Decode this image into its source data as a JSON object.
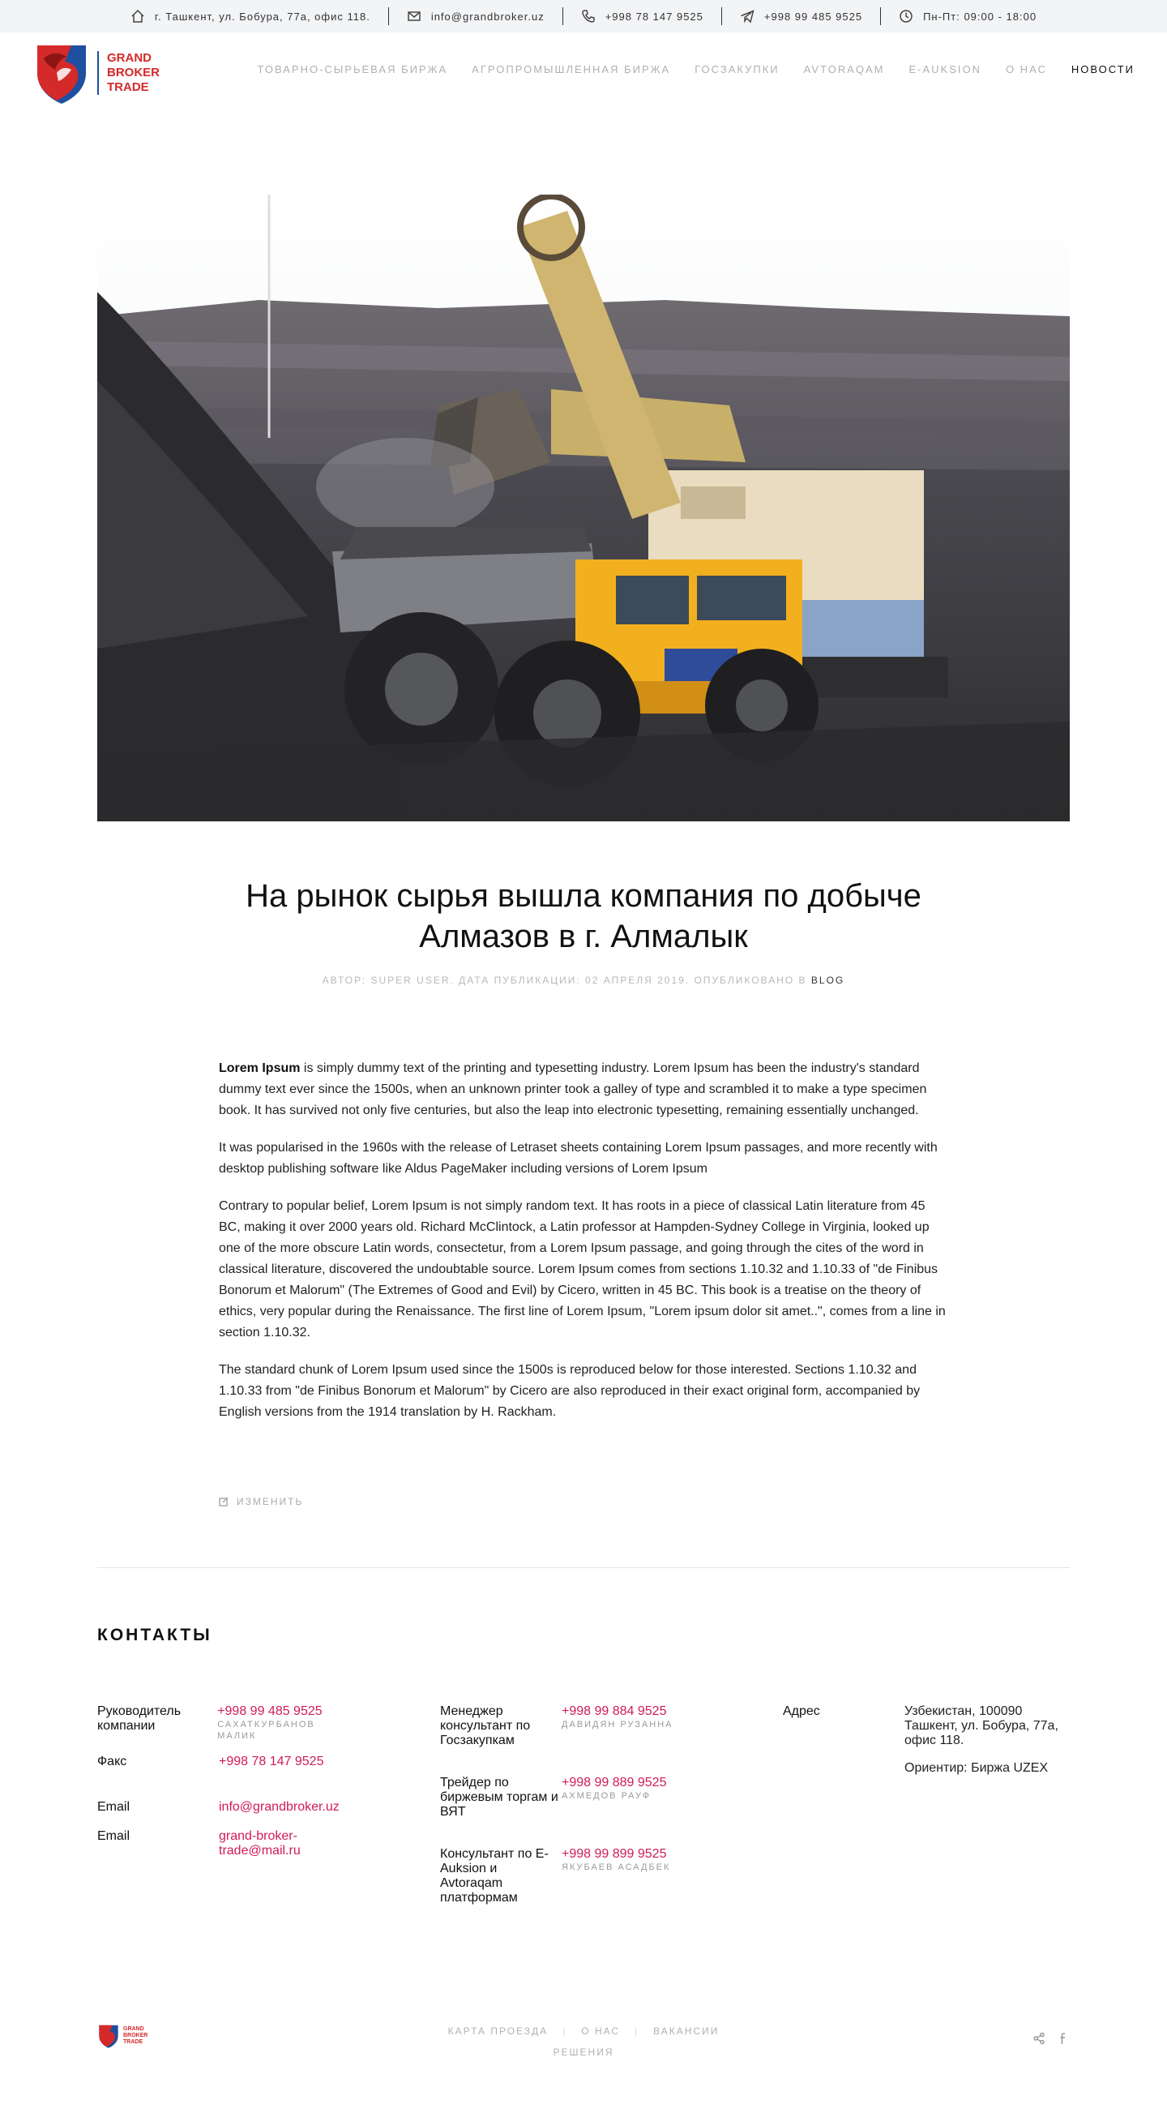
{
  "topbar": {
    "address": "г. Ташкент, ул. Бобура, 77а, офис 118.",
    "email": "info@grandbroker.uz",
    "phone": "+998 78 147 9525",
    "telegram": "+998 99 485 9525",
    "hours": "Пн-Пт: 09:00 - 18:00"
  },
  "logo": {
    "line1": "GRAND",
    "line2": "BROKER",
    "line3": "TRADE",
    "brand_red": "#d42a2a",
    "brand_blue": "#1e4fa0"
  },
  "nav": [
    {
      "label": "ТОВАРНО-СЫРЬЕВАЯ БИРЖА"
    },
    {
      "label": "АГРОПРОМЫШЛЕННАЯ БИРЖА"
    },
    {
      "label": "ГОСЗАКУПКИ"
    },
    {
      "label": "AVTORAQAM"
    },
    {
      "label": "E-AUKSION"
    },
    {
      "label": "О НАС"
    },
    {
      "label": "НОВОСТИ"
    }
  ],
  "article": {
    "title": "На рынок сырья вышла компания по добыче Алмазов в г. Алмалык",
    "meta": "АВТОР: SUPER USER. ДАТА ПУБЛИКАЦИИ: 02 АПРЕЛЯ 2019. ОПУБЛИКОВАНО В",
    "category": "BLOG",
    "lead_bold": "Lorem Ipsum",
    "p1": " is simply dummy text of the printing and typesetting industry. Lorem Ipsum has been the industry's standard dummy text ever since the 1500s, when an unknown printer took a galley of type and scrambled it to make a type specimen book. It has survived not only five centuries, but also the leap into electronic typesetting, remaining essentially unchanged.",
    "p2": "It was popularised in the 1960s with the release of Letraset sheets containing Lorem Ipsum passages, and more recently with desktop publishing software like Aldus PageMaker including versions of Lorem Ipsum",
    "p3": "Contrary to popular belief, Lorem Ipsum is not simply random text. It has roots in a piece of classical Latin literature from 45 BC, making it over 2000 years old. Richard McClintock, a Latin professor at Hampden-Sydney College in Virginia, looked up one of the more obscure Latin words, consectetur, from a Lorem Ipsum passage, and going through the cites of the word in classical literature, discovered the undoubtable source. Lorem Ipsum comes from sections 1.10.32 and 1.10.33 of \"de Finibus Bonorum et Malorum\" (The Extremes of Good and Evil) by Cicero, written in 45 BC. This book is a treatise on the theory of ethics, very popular during the Renaissance. The first line of Lorem Ipsum, \"Lorem ipsum dolor sit amet..\", comes from a line in section 1.10.32.",
    "p4": "The standard chunk of Lorem Ipsum used since the 1500s is reproduced below for those interested. Sections 1.10.32 and 1.10.33 from \"de Finibus Bonorum et Malorum\" by Cicero are also reproduced in their exact original form, accompanied by English versions from the 1914 translation by H. Rackham.",
    "edit": "ИЗМЕНИТЬ"
  },
  "contacts": {
    "title": "КОНТАКТЫ",
    "col1": {
      "head_label": "Руководитель компании",
      "head_phone": "+998 99 485 9525",
      "head_name": "САХАТКУРБАНОВ МАЛИК",
      "fax_label": "Факс",
      "fax": "+998 78 147 9525",
      "email_label": "Email",
      "email": "info@grandbroker.uz",
      "email2_label": "Email",
      "email2": "grand-broker-trade@mail.ru"
    },
    "col2": [
      {
        "label": "Менеджер консультант по Госзакупкам",
        "phone": "+998 99 884 9525",
        "name": "ДАВИДЯН РУЗАННА"
      },
      {
        "label": "Трейдер по биржевым торгам и ВЯТ",
        "phone": "+998 99 889 9525",
        "name": "АХМЕДОВ РАУФ"
      },
      {
        "label": "Консультант по E-Auksion и Avtoraqam платформам",
        "phone": "+998 99 899 9525",
        "name": "ЯКУБАЕВ АСАДБЕК"
      }
    ],
    "col3": {
      "label": "Адрес",
      "address": "Узбекистан, 100090 Ташкент, ул. Бобура, 77а, офис 118.",
      "landmark": "Ориентир: Биржа UZEX"
    }
  },
  "footer": {
    "links": [
      {
        "label": "КАРТА ПРОЕЗДА"
      },
      {
        "label": "О НАС"
      },
      {
        "label": "ВАКАНСИИ"
      },
      {
        "label": "РЕШЕНИЯ"
      }
    ]
  },
  "colors": {
    "accent": "#d11a5a",
    "topbar_bg": "#f3f4f6",
    "truck_yellow": "#f2b01e"
  }
}
